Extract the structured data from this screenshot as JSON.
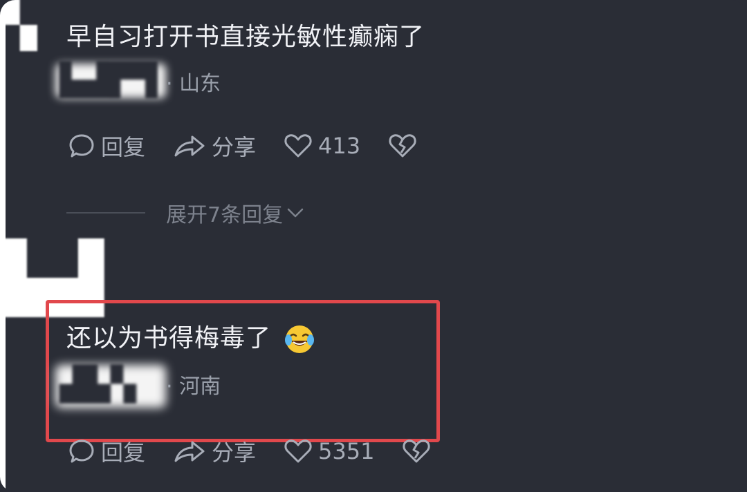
{
  "comment1": {
    "text": "早自习打开书直接光敏性癫痫了",
    "location": "· 山东",
    "actions": {
      "reply_label": "回复",
      "share_label": "分享",
      "like_count": "413"
    },
    "expand_label": "展开7条回复"
  },
  "comment2": {
    "text": "还以为书得梅毒了",
    "location": "· 河南",
    "actions": {
      "reply_label": "回复",
      "share_label": "分享",
      "like_count": "5351"
    }
  },
  "icons": {
    "reply": "speech-bubble-icon",
    "share": "share-arrow-icon",
    "like": "heart-icon",
    "dislike": "broken-heart-icon",
    "expand": "chevron-down-icon",
    "emoji": "laughing-crying-emoji-icon"
  },
  "colors": {
    "background": "#2a2d36",
    "text": "#f1f2f6",
    "muted": "#9aa0ab",
    "highlight": "#e1484c"
  }
}
